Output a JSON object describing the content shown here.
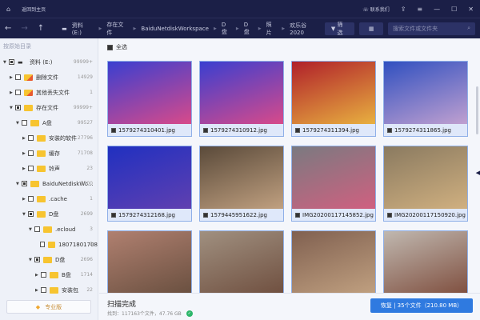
{
  "header": {
    "back_home": "返回到主页",
    "contact": "联系我们"
  },
  "toolbar": {
    "breadcrumb": [
      "资料 (E:)",
      "存在文件",
      "BaiduNetdiskWorkspace",
      "D盘",
      "D盘",
      "照片",
      "欢乐谷2020"
    ],
    "filter": "筛选",
    "search_placeholder": "搜索文件或文件夹"
  },
  "sidebar": {
    "heading": "按原始目录",
    "tree": [
      {
        "label": "资料 (E:)",
        "count": "99999+",
        "level": 0,
        "exp": "down",
        "cb": "p",
        "icon": "drive"
      },
      {
        "label": "删除文件",
        "count": "14929",
        "level": 1,
        "exp": "right",
        "cb": "",
        "icon": "del"
      },
      {
        "label": "其他丢失文件",
        "count": "1",
        "level": 1,
        "exp": "right",
        "cb": "",
        "icon": "del"
      },
      {
        "label": "存在文件",
        "count": "99999+",
        "level": 1,
        "exp": "down",
        "cb": "p",
        "icon": "folder"
      },
      {
        "label": "A盘",
        "count": "99527",
        "level": 2,
        "exp": "down",
        "cb": "",
        "icon": "folder"
      },
      {
        "label": "安装的软件",
        "count": "27796",
        "level": 3,
        "exp": "right",
        "cb": "",
        "icon": "folder"
      },
      {
        "label": "缓存",
        "count": "71708",
        "level": 3,
        "exp": "right",
        "cb": "",
        "icon": "folder"
      },
      {
        "label": "铃声",
        "count": "23",
        "level": 3,
        "exp": "right",
        "cb": "",
        "icon": "folder"
      },
      {
        "label": "BaiduNetdiskWo...",
        "count": "2700",
        "level": 2,
        "exp": "down",
        "cb": "p",
        "icon": "folder"
      },
      {
        "label": ".cache",
        "count": "1",
        "level": 3,
        "exp": "right",
        "cb": "",
        "icon": "folder"
      },
      {
        "label": "D盘",
        "count": "2699",
        "level": 3,
        "exp": "down",
        "cb": "p",
        "icon": "folder"
      },
      {
        "label": ".ecloud",
        "count": "3",
        "level": 4,
        "exp": "down",
        "cb": "",
        "icon": "folder"
      },
      {
        "label": "18071801708",
        "count": "3",
        "level": 5,
        "exp": "",
        "cb": "",
        "icon": "folder"
      },
      {
        "label": "D盘",
        "count": "2696",
        "level": 4,
        "exp": "down",
        "cb": "p",
        "icon": "folder"
      },
      {
        "label": "B盘",
        "count": "1714",
        "level": 5,
        "exp": "right",
        "cb": "",
        "icon": "folder"
      },
      {
        "label": "安装包",
        "count": "22",
        "level": 5,
        "exp": "right",
        "cb": "",
        "icon": "folder"
      }
    ],
    "pro": "专业版"
  },
  "main": {
    "select_all": "全选",
    "files": [
      {
        "name": "1579274310401.jpg",
        "c": [
          "#3a3fd0",
          "#d84a8a"
        ]
      },
      {
        "name": "1579274310912.jpg",
        "c": [
          "#3a3fd0",
          "#d84a8a"
        ]
      },
      {
        "name": "1579274311394.jpg",
        "c": [
          "#b0202a",
          "#e8b040"
        ]
      },
      {
        "name": "1579274311865.jpg",
        "c": [
          "#3050c0",
          "#c0a0d0"
        ]
      },
      {
        "name": "1579274312168.jpg",
        "c": [
          "#2030c0",
          "#6040b0"
        ]
      },
      {
        "name": "1579445951622.jpg",
        "c": [
          "#5a4a3a",
          "#c0a080"
        ]
      },
      {
        "name": "IMG20200117145852.jpg",
        "c": [
          "#7a7a80",
          "#d06080"
        ]
      },
      {
        "name": "IMG20200117150920.jpg",
        "c": [
          "#8a7a60",
          "#d0b080"
        ]
      },
      {
        "name": "",
        "c": [
          "#b08070",
          "#6a5040"
        ]
      },
      {
        "name": "",
        "c": [
          "#a09080",
          "#705040"
        ]
      },
      {
        "name": "",
        "c": [
          "#806050",
          "#c0a080"
        ]
      },
      {
        "name": "",
        "c": [
          "#c0b8b0",
          "#805040"
        ]
      }
    ]
  },
  "footer": {
    "status": "扫描完成",
    "found": "找到：117163个文件，47.76 GB",
    "recover": "恢复 | 35个文件（210.80 MB）"
  }
}
